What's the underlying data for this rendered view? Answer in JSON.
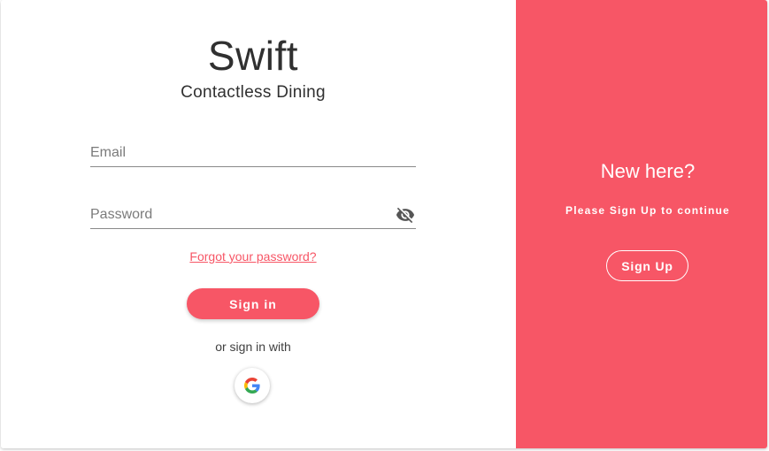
{
  "brand": {
    "title": "Swift",
    "subtitle": "Contactless Dining"
  },
  "login_form": {
    "email_placeholder": "Email",
    "password_placeholder": "Password",
    "forgot_password_label": "Forgot your password?",
    "signin_label": "Sign in",
    "or_text": "or sign in with",
    "google_icon": "google-icon",
    "password_toggle_icon": "eye-off-icon"
  },
  "signup_panel": {
    "title": "New here?",
    "subtitle": "Please Sign Up to continue",
    "signup_label": "Sign Up"
  },
  "colors": {
    "accent": "#f75666",
    "text": "#303030",
    "panel_text": "#ffffff"
  }
}
